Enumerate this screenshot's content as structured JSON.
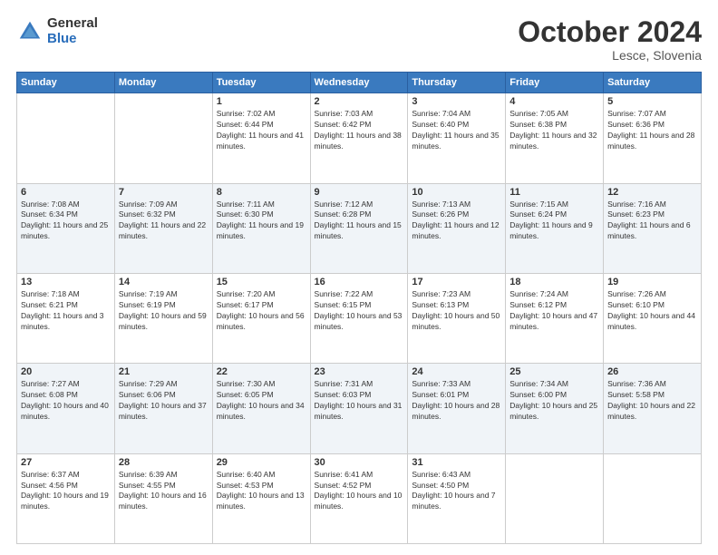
{
  "header": {
    "logo_general": "General",
    "logo_blue": "Blue",
    "month_title": "October 2024",
    "location": "Lesce, Slovenia"
  },
  "calendar": {
    "days_of_week": [
      "Sunday",
      "Monday",
      "Tuesday",
      "Wednesday",
      "Thursday",
      "Friday",
      "Saturday"
    ],
    "weeks": [
      [
        {
          "day": "",
          "info": ""
        },
        {
          "day": "",
          "info": ""
        },
        {
          "day": "1",
          "info": "Sunrise: 7:02 AM\nSunset: 6:44 PM\nDaylight: 11 hours and 41 minutes."
        },
        {
          "day": "2",
          "info": "Sunrise: 7:03 AM\nSunset: 6:42 PM\nDaylight: 11 hours and 38 minutes."
        },
        {
          "day": "3",
          "info": "Sunrise: 7:04 AM\nSunset: 6:40 PM\nDaylight: 11 hours and 35 minutes."
        },
        {
          "day": "4",
          "info": "Sunrise: 7:05 AM\nSunset: 6:38 PM\nDaylight: 11 hours and 32 minutes."
        },
        {
          "day": "5",
          "info": "Sunrise: 7:07 AM\nSunset: 6:36 PM\nDaylight: 11 hours and 28 minutes."
        }
      ],
      [
        {
          "day": "6",
          "info": "Sunrise: 7:08 AM\nSunset: 6:34 PM\nDaylight: 11 hours and 25 minutes."
        },
        {
          "day": "7",
          "info": "Sunrise: 7:09 AM\nSunset: 6:32 PM\nDaylight: 11 hours and 22 minutes."
        },
        {
          "day": "8",
          "info": "Sunrise: 7:11 AM\nSunset: 6:30 PM\nDaylight: 11 hours and 19 minutes."
        },
        {
          "day": "9",
          "info": "Sunrise: 7:12 AM\nSunset: 6:28 PM\nDaylight: 11 hours and 15 minutes."
        },
        {
          "day": "10",
          "info": "Sunrise: 7:13 AM\nSunset: 6:26 PM\nDaylight: 11 hours and 12 minutes."
        },
        {
          "day": "11",
          "info": "Sunrise: 7:15 AM\nSunset: 6:24 PM\nDaylight: 11 hours and 9 minutes."
        },
        {
          "day": "12",
          "info": "Sunrise: 7:16 AM\nSunset: 6:23 PM\nDaylight: 11 hours and 6 minutes."
        }
      ],
      [
        {
          "day": "13",
          "info": "Sunrise: 7:18 AM\nSunset: 6:21 PM\nDaylight: 11 hours and 3 minutes."
        },
        {
          "day": "14",
          "info": "Sunrise: 7:19 AM\nSunset: 6:19 PM\nDaylight: 10 hours and 59 minutes."
        },
        {
          "day": "15",
          "info": "Sunrise: 7:20 AM\nSunset: 6:17 PM\nDaylight: 10 hours and 56 minutes."
        },
        {
          "day": "16",
          "info": "Sunrise: 7:22 AM\nSunset: 6:15 PM\nDaylight: 10 hours and 53 minutes."
        },
        {
          "day": "17",
          "info": "Sunrise: 7:23 AM\nSunset: 6:13 PM\nDaylight: 10 hours and 50 minutes."
        },
        {
          "day": "18",
          "info": "Sunrise: 7:24 AM\nSunset: 6:12 PM\nDaylight: 10 hours and 47 minutes."
        },
        {
          "day": "19",
          "info": "Sunrise: 7:26 AM\nSunset: 6:10 PM\nDaylight: 10 hours and 44 minutes."
        }
      ],
      [
        {
          "day": "20",
          "info": "Sunrise: 7:27 AM\nSunset: 6:08 PM\nDaylight: 10 hours and 40 minutes."
        },
        {
          "day": "21",
          "info": "Sunrise: 7:29 AM\nSunset: 6:06 PM\nDaylight: 10 hours and 37 minutes."
        },
        {
          "day": "22",
          "info": "Sunrise: 7:30 AM\nSunset: 6:05 PM\nDaylight: 10 hours and 34 minutes."
        },
        {
          "day": "23",
          "info": "Sunrise: 7:31 AM\nSunset: 6:03 PM\nDaylight: 10 hours and 31 minutes."
        },
        {
          "day": "24",
          "info": "Sunrise: 7:33 AM\nSunset: 6:01 PM\nDaylight: 10 hours and 28 minutes."
        },
        {
          "day": "25",
          "info": "Sunrise: 7:34 AM\nSunset: 6:00 PM\nDaylight: 10 hours and 25 minutes."
        },
        {
          "day": "26",
          "info": "Sunrise: 7:36 AM\nSunset: 5:58 PM\nDaylight: 10 hours and 22 minutes."
        }
      ],
      [
        {
          "day": "27",
          "info": "Sunrise: 6:37 AM\nSunset: 4:56 PM\nDaylight: 10 hours and 19 minutes."
        },
        {
          "day": "28",
          "info": "Sunrise: 6:39 AM\nSunset: 4:55 PM\nDaylight: 10 hours and 16 minutes."
        },
        {
          "day": "29",
          "info": "Sunrise: 6:40 AM\nSunset: 4:53 PM\nDaylight: 10 hours and 13 minutes."
        },
        {
          "day": "30",
          "info": "Sunrise: 6:41 AM\nSunset: 4:52 PM\nDaylight: 10 hours and 10 minutes."
        },
        {
          "day": "31",
          "info": "Sunrise: 6:43 AM\nSunset: 4:50 PM\nDaylight: 10 hours and 7 minutes."
        },
        {
          "day": "",
          "info": ""
        },
        {
          "day": "",
          "info": ""
        }
      ]
    ]
  }
}
